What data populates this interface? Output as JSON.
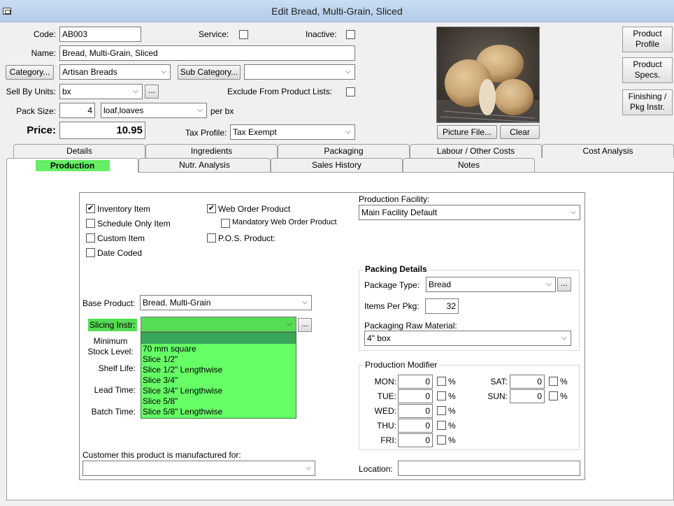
{
  "window": {
    "title": "Edit Bread, Multi-Grain, Sliced"
  },
  "header": {
    "code_label": "Code:",
    "code_value": "AB003",
    "service_label": "Service:",
    "inactive_label": "Inactive:",
    "name_label": "Name:",
    "name_value": "Bread, Multi-Grain, Sliced",
    "category_button": "Category...",
    "category_value": "Artisan Breads",
    "subcategory_button": "Sub Category...",
    "subcategory_value": "",
    "sellby_label": "Sell By Units:",
    "sellby_value": "bx",
    "exclude_label": "Exclude From Product Lists:",
    "packsize_label": "Pack Size:",
    "packsize_value": "4",
    "packsize_unit": "loaf,loaves",
    "per_label": "per bx",
    "price_label": "Price:",
    "price_value": "10.95",
    "taxprofile_label": "Tax Profile:",
    "taxprofile_value": "Tax Exempt",
    "ellipsis": "..."
  },
  "picture": {
    "file_button": "Picture File...",
    "clear_button": "Clear"
  },
  "side_buttons": {
    "profile": [
      "Product",
      "Profile"
    ],
    "specs": [
      "Product",
      "Specs."
    ],
    "finishing": [
      "Finishing /",
      "Pkg Instr."
    ]
  },
  "tabs": {
    "row1": [
      "Details",
      "Ingredients",
      "Packaging",
      "Labour / Other Costs",
      "Cost Analysis"
    ],
    "row2": [
      "Production",
      "Nutr. Analysis",
      "Sales History",
      "Notes"
    ]
  },
  "production": {
    "inventory_item": "Inventory Item",
    "schedule_only": "Schedule Only Item",
    "custom_item": "Custom Item",
    "date_coded": "Date Coded",
    "web_order": "Web Order Product",
    "mandatory_web": "Mandatory Web Order Product",
    "pos_product": "P.O.S. Product:",
    "checked": "✔",
    "facility_label": "Production Facility:",
    "facility_value": "Main Facility Default",
    "base_product_label": "Base Product:",
    "base_product_value": "Bread, Multi-Grain",
    "slicing_label": "Slicing Instr:",
    "slicing_value": "",
    "slicing_options": [
      "",
      "70 mm square",
      "Slice 1/2\"",
      "Slice 1/2\" Lengthwise",
      "Slice 3/4\"",
      "Slice 3/4\" Lengthwise",
      "Slice 5/8\"",
      "Slice 5/8\" Lengthwise"
    ],
    "min_stock_label_1": "Minimum",
    "min_stock_label_2": "Stock Level:",
    "shelf_life_label": "Shelf Life:",
    "lead_time_label": "Lead Time:",
    "batch_time_label": "Batch Time:",
    "customer_label": "Customer this product is manufactured for:",
    "customer_value": "",
    "location_label": "Location:",
    "location_value": ""
  },
  "packing": {
    "title": "Packing Details",
    "package_type_label": "Package Type:",
    "package_type_value": "Bread",
    "items_per_pkg_label": "Items Per Pkg:",
    "items_per_pkg_value": "32",
    "raw_material_label": "Packaging Raw Material:",
    "raw_material_value": "4\" box"
  },
  "modifier": {
    "title": "Production Modifier",
    "pct": "%",
    "days": [
      {
        "label": "MON:",
        "value": "0"
      },
      {
        "label": "TUE:",
        "value": "0"
      },
      {
        "label": "WED:",
        "value": "0"
      },
      {
        "label": "THU:",
        "value": "0"
      },
      {
        "label": "FRI:",
        "value": "0"
      },
      {
        "label": "SAT:",
        "value": "0"
      },
      {
        "label": "SUN:",
        "value": "0"
      }
    ]
  },
  "colors": {
    "active_tab": "#66ee66",
    "dropdown": "#66ff66",
    "slicing_highlight": "#55dd55"
  }
}
